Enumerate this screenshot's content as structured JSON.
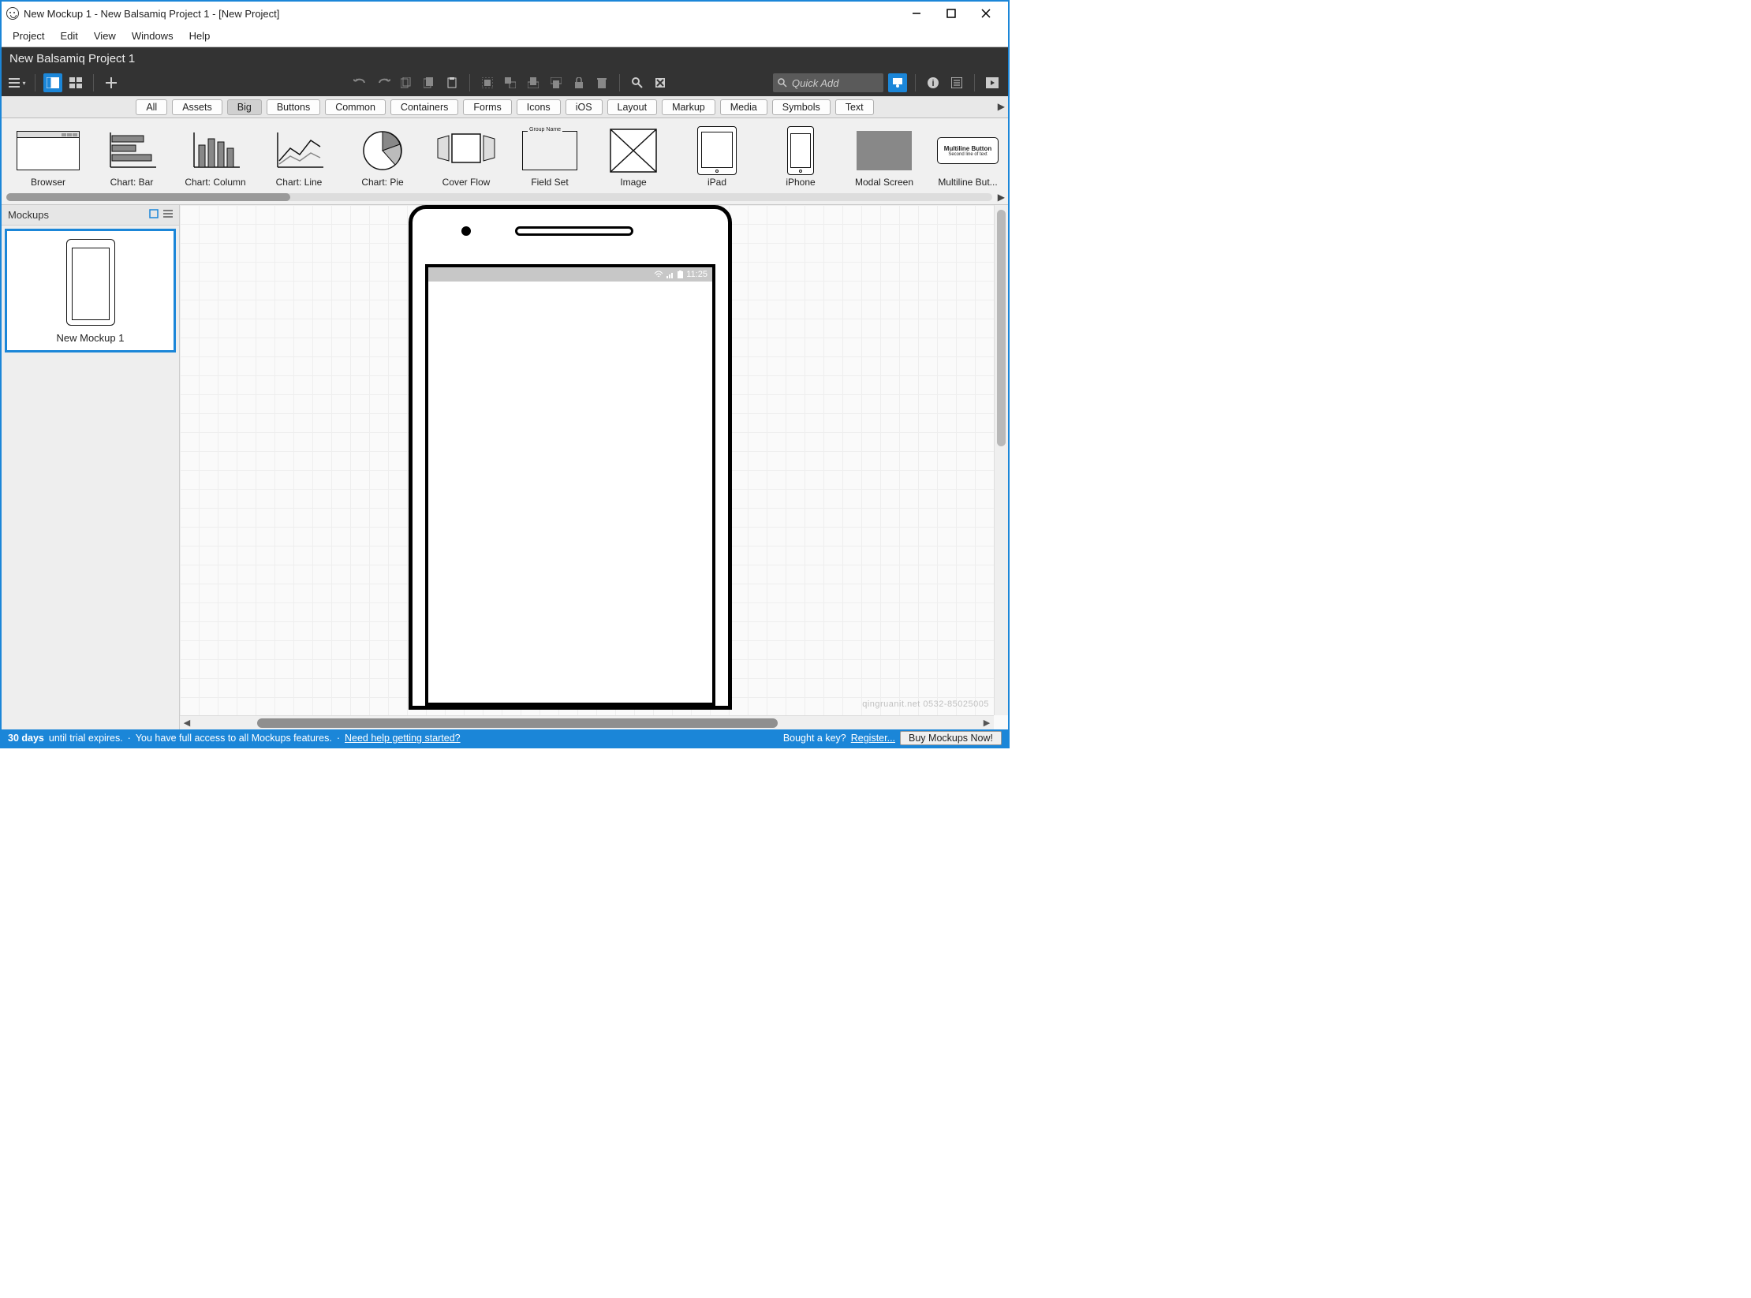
{
  "window": {
    "title": "New Mockup 1 - New Balsamiq Project 1 - [New Project]"
  },
  "menubar": [
    "Project",
    "Edit",
    "View",
    "Windows",
    "Help"
  ],
  "project_header": "New Balsamiq Project 1",
  "quick_add": {
    "placeholder": "Quick Add"
  },
  "library_tabs": [
    "All",
    "Assets",
    "Big",
    "Buttons",
    "Common",
    "Containers",
    "Forms",
    "Icons",
    "iOS",
    "Layout",
    "Markup",
    "Media",
    "Symbols",
    "Text"
  ],
  "library_active_tab": "Big",
  "library_items": [
    {
      "label": "Browser"
    },
    {
      "label": "Chart: Bar"
    },
    {
      "label": "Chart: Column"
    },
    {
      "label": "Chart: Line"
    },
    {
      "label": "Chart: Pie"
    },
    {
      "label": "Cover Flow"
    },
    {
      "label": "Field Set",
      "sub": "Group Name"
    },
    {
      "label": "Image"
    },
    {
      "label": "iPad"
    },
    {
      "label": "iPhone"
    },
    {
      "label": "Modal Screen"
    },
    {
      "label": "Multiline But...",
      "sub1": "Multiline Button",
      "sub2": "Second line of text"
    }
  ],
  "navigator": {
    "title": "Mockups",
    "items": [
      {
        "label": "New Mockup 1"
      }
    ]
  },
  "canvas": {
    "phone_status_time": "11:25"
  },
  "footer": {
    "days": "30 days",
    "trial": " until trial expires.",
    "access": "You have full access to all Mockups features.",
    "help": "Need help getting started?",
    "bought": "Bought a key? ",
    "register": "Register...",
    "buy": "Buy Mockups Now!"
  },
  "watermark": "qingruanit.net 0532-85025005"
}
